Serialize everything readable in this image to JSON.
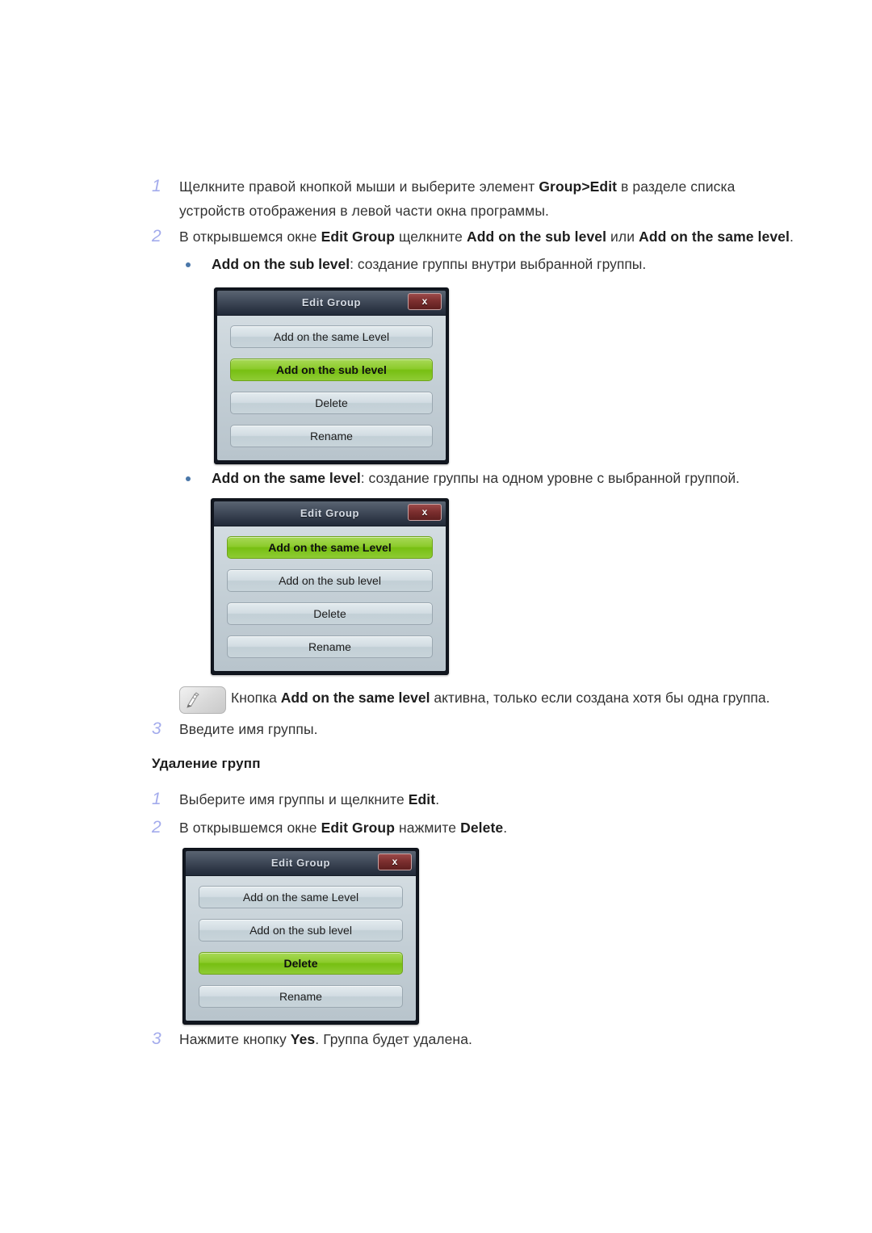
{
  "steps": {
    "s1": {
      "num": "1",
      "line1_a": "Щелкните правой кнопкой мыши и выберите элемент ",
      "line1_b": "Group>Edit",
      "line1_c": " в разделе списка",
      "line2": "устройств отображения в левой части окна программы."
    },
    "s2": {
      "num": "2",
      "a": "В открывшемся окне ",
      "b": "Edit Group",
      "c": " щелкните ",
      "d": "Add on the sub level",
      "e": " или ",
      "f": "Add on the same level",
      "g": "."
    },
    "s3": {
      "num": "3",
      "text": "Введите имя группы."
    },
    "d1": {
      "num": "1",
      "a": "Выберите имя группы и щелкните ",
      "b": "Edit",
      "c": "."
    },
    "d2": {
      "num": "2",
      "a": "В открывшемся окне ",
      "b": "Edit Group",
      "c": " нажмите ",
      "d": "Delete",
      "e": "."
    },
    "d3": {
      "num": "3",
      "a": "Нажмите кнопку ",
      "b": "Yes",
      "c": ". Группа будет удалена."
    }
  },
  "bullets": {
    "sub_level": {
      "bold": "Add on the sub level",
      "rest": ": создание группы внутри выбранной группы."
    },
    "same_level": {
      "bold": "Add on the same level",
      "rest": ": создание группы на одном уровне с выбранной группой."
    }
  },
  "note": {
    "icon": "note-pencil-icon",
    "a": "Кнопка ",
    "b": "Add on the same level",
    "c": " активна, только если создана хотя бы одна группа."
  },
  "section_heading": "Удаление групп",
  "dialogs": {
    "common": {
      "title": "Edit Group",
      "close_label": "x",
      "close_icon": "close-icon"
    },
    "dialog1": {
      "buttons": [
        {
          "label": "Add on the same Level",
          "active": false
        },
        {
          "label": "Add on the sub level",
          "active": true
        },
        {
          "label": "Delete",
          "active": false
        },
        {
          "label": "Rename",
          "active": false
        }
      ]
    },
    "dialog2": {
      "buttons": [
        {
          "label": "Add on the same Level",
          "active": true
        },
        {
          "label": "Add on the sub level",
          "active": false
        },
        {
          "label": "Delete",
          "active": false
        },
        {
          "label": "Rename",
          "active": false
        }
      ]
    },
    "dialog3": {
      "buttons": [
        {
          "label": "Add on the same Level",
          "active": false
        },
        {
          "label": "Add on the sub level",
          "active": false
        },
        {
          "label": "Delete",
          "active": true
        },
        {
          "label": "Rename",
          "active": false
        }
      ]
    }
  },
  "colors": {
    "step_number": "#a3abec",
    "bullet": "#4a77a9",
    "button_active_green": "#8ccb2c",
    "dialog_body": "#c8d3da",
    "titlebar_dark": "#2e3746",
    "close_red": "#7d2f2f"
  }
}
